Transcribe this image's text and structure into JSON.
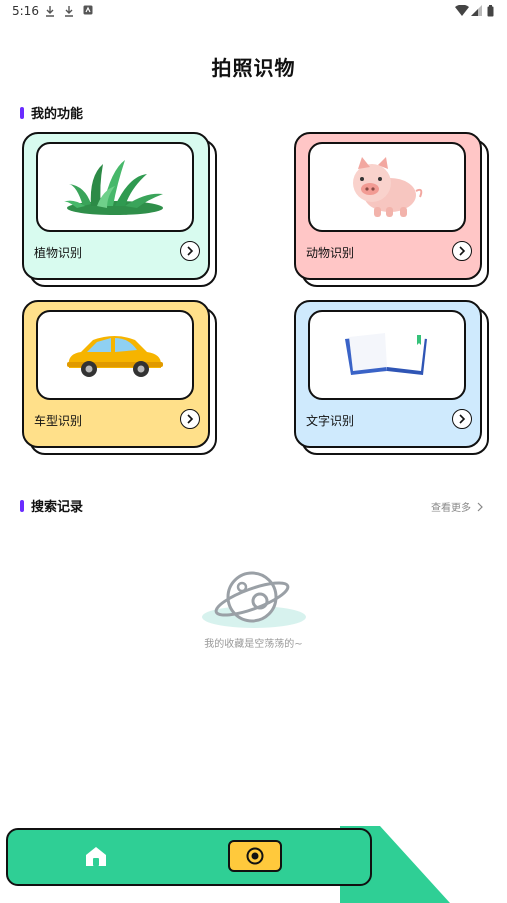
{
  "status_bar": {
    "time": "5:16"
  },
  "page": {
    "title": "拍照识物"
  },
  "functions": {
    "section_title": "我的功能",
    "cards": [
      {
        "label": "植物识别",
        "color": "#d8fbef",
        "icon": "plant"
      },
      {
        "label": "动物识别",
        "color": "#ffc6c6",
        "icon": "pig"
      },
      {
        "label": "车型识别",
        "color": "#ffe08a",
        "icon": "car"
      },
      {
        "label": "文字识别",
        "color": "#cfeafd",
        "icon": "book"
      }
    ]
  },
  "search": {
    "section_title": "搜索记录",
    "more_label": "查看更多",
    "empty_text": "我的收藏是空荡荡的~"
  },
  "nav": {
    "accent": "#2fcf95",
    "camera_color": "#ffc93c"
  }
}
